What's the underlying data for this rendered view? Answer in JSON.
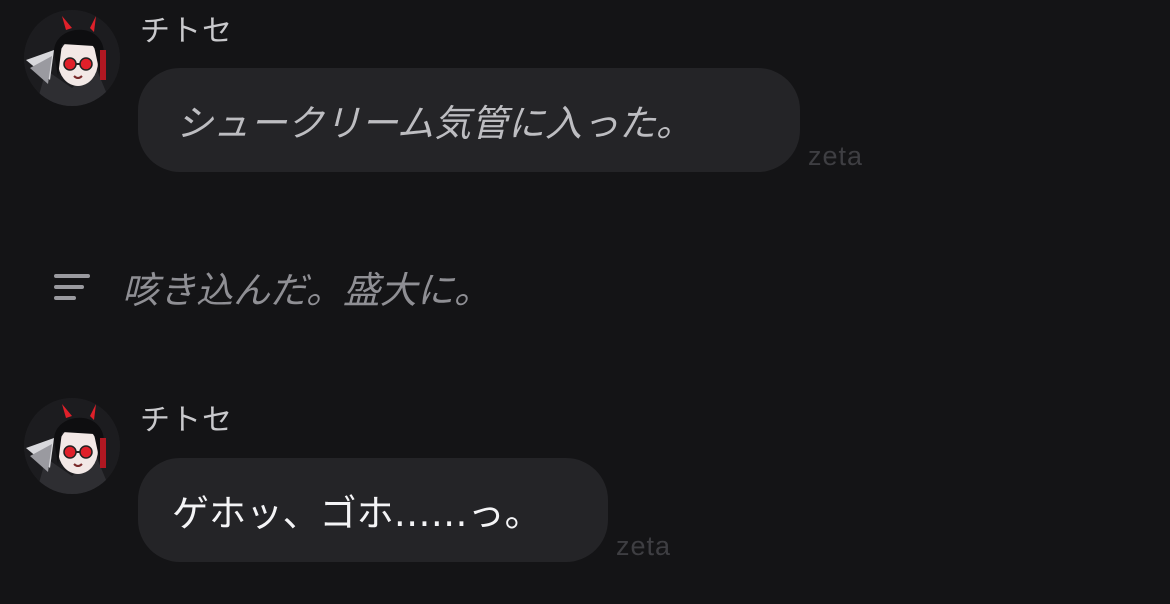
{
  "messages": [
    {
      "sender": "チトセ",
      "text": "シュークリーム気管に入った。",
      "meta": "zeta",
      "style": "italic"
    },
    {
      "sender": "チトセ",
      "text": "ゲホッ、ゴホ……っ。",
      "meta": "zeta",
      "style": "plain"
    }
  ],
  "narration": {
    "icon": "text-lines-icon",
    "text": "咳き込んだ。盛大に。"
  },
  "colors": {
    "background": "#141416",
    "bubble": "#242427",
    "accent_red": "#e0202a"
  }
}
